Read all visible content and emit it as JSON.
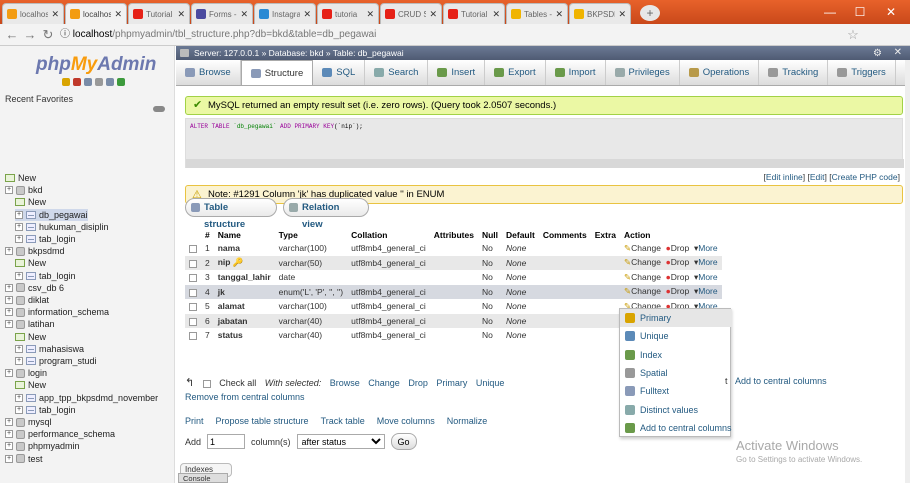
{
  "browser": {
    "tabs": [
      {
        "title": "localhost",
        "color": "#f39c12"
      },
      {
        "title": "localhost",
        "color": "#f39c12"
      },
      {
        "title": "Tutorial",
        "color": "#e62117"
      },
      {
        "title": "Forms -",
        "color": "#4a4aa0"
      },
      {
        "title": "Instagram",
        "color": "#2a8ad4"
      },
      {
        "title": "tutoria",
        "color": "#e62117"
      },
      {
        "title": "CRUD S",
        "color": "#e62117"
      },
      {
        "title": "Tutorial",
        "color": "#e62117"
      },
      {
        "title": "Tables -",
        "color": "#f0b400"
      },
      {
        "title": "BKPSDM",
        "color": "#f0b400"
      }
    ],
    "url_host": "localhost",
    "url_path": "/phpmyadmin/tbl_structure.php?db=bkd&table=db_pegawai",
    "new_tab": "+",
    "win_min": "—",
    "win_max": "☐",
    "win_close": "✕"
  },
  "sidebar": {
    "logo_php": "php",
    "logo_my": "My",
    "logo_admin": "Admin",
    "recent_favorites": "Recent  Favorites",
    "tree": [
      {
        "label": "New",
        "type": "new",
        "indent": 0
      },
      {
        "label": "bkd",
        "type": "db",
        "indent": 0
      },
      {
        "label": "New",
        "type": "new",
        "indent": 1
      },
      {
        "label": "db_pegawai",
        "type": "table",
        "indent": 1
      },
      {
        "label": "hukuman_disiplin",
        "type": "table",
        "indent": 1
      },
      {
        "label": "tab_login",
        "type": "table",
        "indent": 1
      },
      {
        "label": "bkpsdmd",
        "type": "db",
        "indent": 0
      },
      {
        "label": "New",
        "type": "new",
        "indent": 1
      },
      {
        "label": "tab_login",
        "type": "table",
        "indent": 1
      },
      {
        "label": "csv_db 6",
        "type": "db",
        "indent": 0
      },
      {
        "label": "diklat",
        "type": "db",
        "indent": 0
      },
      {
        "label": "information_schema",
        "type": "db",
        "indent": 0
      },
      {
        "label": "latihan",
        "type": "db",
        "indent": 0
      },
      {
        "label": "New",
        "type": "new",
        "indent": 1
      },
      {
        "label": "mahasiswa",
        "type": "table",
        "indent": 1
      },
      {
        "label": "program_studi",
        "type": "table",
        "indent": 1
      },
      {
        "label": "login",
        "type": "db",
        "indent": 0
      },
      {
        "label": "New",
        "type": "new",
        "indent": 1
      },
      {
        "label": "app_tpp_bkpsdmd_november",
        "type": "table",
        "indent": 1
      },
      {
        "label": "tab_login",
        "type": "table",
        "indent": 1
      },
      {
        "label": "mysql",
        "type": "db",
        "indent": 0
      },
      {
        "label": "performance_schema",
        "type": "db",
        "indent": 0
      },
      {
        "label": "phpmyadmin",
        "type": "db",
        "indent": 0
      },
      {
        "label": "test",
        "type": "db",
        "indent": 0
      }
    ]
  },
  "breadcrumb": "Server: 127.0.0.1 » Database: bkd » Table: db_pegawai",
  "menu": [
    "Browse",
    "Structure",
    "SQL",
    "Search",
    "Insert",
    "Export",
    "Import",
    "Privileges",
    "Operations",
    "Tracking",
    "Triggers"
  ],
  "success_msg": "MySQL returned an empty result set (i.e. zero rows). (Query took 2.0507 seconds.)",
  "sql": {
    "kw1": "ALTER TABLE",
    "tbl": "`db_pegawai`",
    "kw2": "ADD PRIMARY KEY",
    "cols": "(`nip`);"
  },
  "sql_links": {
    "edit_inline": "Edit inline",
    "edit": "Edit",
    "create_php": "Create PHP code"
  },
  "notice_msg": "Note: #1291 Column 'jk' has duplicated value '' in ENUM",
  "subtabs": [
    "Table structure",
    "Relation view"
  ],
  "columns": [
    "#",
    "Name",
    "Type",
    "Collation",
    "Attributes",
    "Null",
    "Default",
    "Comments",
    "Extra",
    "Action"
  ],
  "rows": [
    {
      "n": "1",
      "name": "nama",
      "type": "varchar(100)",
      "collation": "utf8mb4_general_ci",
      "null": "No",
      "default": "None"
    },
    {
      "n": "2",
      "name": "nip",
      "type": "varchar(50)",
      "collation": "utf8mb4_general_ci",
      "null": "No",
      "default": "None"
    },
    {
      "n": "3",
      "name": "tanggal_lahir",
      "type": "date",
      "collation": "",
      "null": "No",
      "default": "None"
    },
    {
      "n": "4",
      "name": "jk",
      "type": "enum('L', 'P', '', '')",
      "collation": "utf8mb4_general_ci",
      "null": "No",
      "default": "None"
    },
    {
      "n": "5",
      "name": "alamat",
      "type": "varchar(100)",
      "collation": "utf8mb4_general_ci",
      "null": "No",
      "default": "None"
    },
    {
      "n": "6",
      "name": "jabatan",
      "type": "varchar(40)",
      "collation": "utf8mb4_general_ci",
      "null": "No",
      "default": "None"
    },
    {
      "n": "7",
      "name": "status",
      "type": "varchar(40)",
      "collation": "utf8mb4_general_ci",
      "null": "No",
      "default": "None"
    }
  ],
  "actions": {
    "change": "Change",
    "drop": "Drop",
    "more": "More"
  },
  "dropdown": [
    "Primary",
    "Unique",
    "Index",
    "Spatial",
    "Fulltext",
    "Distinct values",
    "Add to central columns"
  ],
  "bulk": {
    "check_all": "Check all",
    "with_selected": "With selected:",
    "browse": "Browse",
    "change": "Change",
    "drop": "Drop",
    "primary": "Primary",
    "unique": "Unique",
    "add_central": "Add to central columns",
    "remove_central": "Remove from central columns",
    "t_letter": "t"
  },
  "bottom_links": [
    "Print",
    "Propose table structure",
    "Track table",
    "Move columns",
    "Normalize"
  ],
  "add_row": {
    "label": "Add",
    "value": "1",
    "suffix": "column(s)",
    "position": "after status",
    "go": "Go"
  },
  "indexes": "Indexes",
  "console": "Console",
  "watermark": {
    "line1": "Activate Windows",
    "line2": "Go to Settings to activate Windows."
  }
}
